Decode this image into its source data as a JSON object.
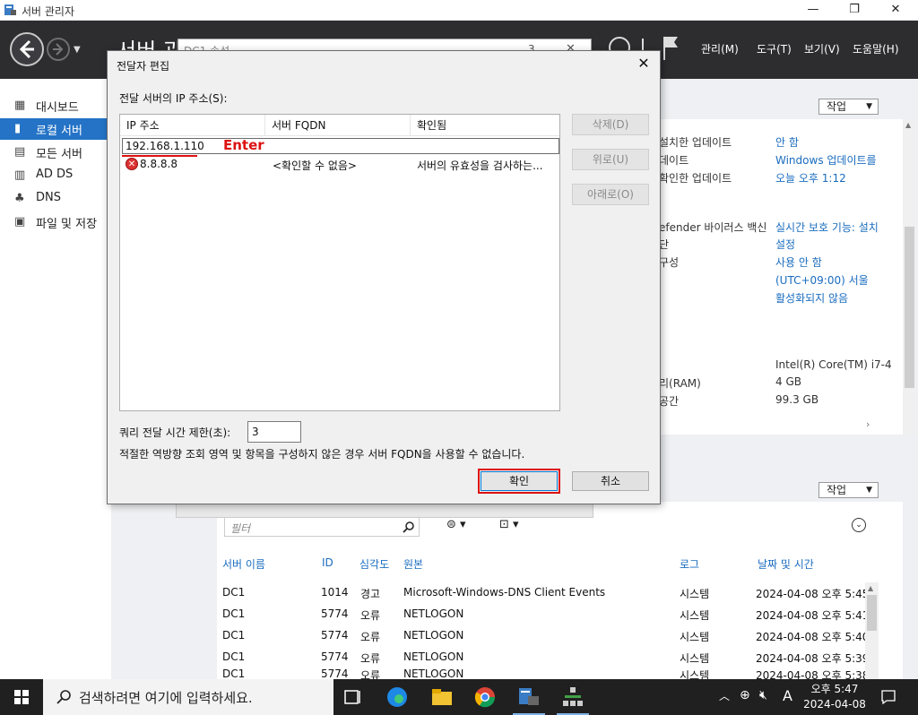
{
  "window": {
    "title": "서버 관리자",
    "minimize": "—",
    "maximize": "❐",
    "close": "✕"
  },
  "header": {
    "breadcrumb_title": "서버 관",
    "search_placeholder": "DC1 속성",
    "search_count": "3",
    "menus": [
      "관리(M)",
      "도구(T)",
      "보기(V)",
      "도움말(H)"
    ]
  },
  "sidebar": {
    "items": [
      {
        "label": "대시보드",
        "icon": "dashboard-icon"
      },
      {
        "label": "로컬 서버",
        "icon": "local-server-icon",
        "active": true
      },
      {
        "label": "모든 서버",
        "icon": "all-servers-icon"
      },
      {
        "label": "AD DS",
        "icon": "ad-ds-icon"
      },
      {
        "label": "DNS",
        "icon": "dns-icon"
      },
      {
        "label": "파일 및 저장",
        "icon": "file-storage-icon"
      }
    ]
  },
  "properties": {
    "task_label": "작업",
    "left": [
      "설치한 업데이트",
      "데이트",
      "확인한 업데이트",
      "efender 바이러스 백신",
      "단",
      "구성",
      "리(RAM)",
      "공간"
    ],
    "right": [
      "안 함",
      "Windows 업데이트를",
      "오늘 오후 1:12",
      "실시간 보호 기능: 설치",
      "설정",
      "사용 안 함",
      "(UTC+09:00) 서울",
      "활성화되지 않음",
      "Intel(R) Core(TM) i7-4",
      "4 GB",
      "99.3 GB"
    ]
  },
  "events": {
    "task_label": "작업",
    "filter_placeholder": "필터",
    "columns": [
      "서버 이름",
      "ID",
      "심각도",
      "원본",
      "로그",
      "날짜 및 시간"
    ],
    "rows": [
      [
        "DC1",
        "1014",
        "경고",
        "Microsoft-Windows-DNS Client Events",
        "시스템",
        "2024-04-08 오후 5:45"
      ],
      [
        "DC1",
        "5774",
        "오류",
        "NETLOGON",
        "시스템",
        "2024-04-08 오후 5:41"
      ],
      [
        "DC1",
        "5774",
        "오류",
        "NETLOGON",
        "시스템",
        "2024-04-08 오후 5:40"
      ],
      [
        "DC1",
        "5774",
        "오류",
        "NETLOGON",
        "시스템",
        "2024-04-08 오후 5:39"
      ],
      [
        "DC1",
        "5774",
        "오류",
        "NETLOGON",
        "시스템",
        "2024-04-08 오후 5:38"
      ]
    ]
  },
  "dialog": {
    "title": "전달자 편집",
    "close": "✕",
    "ip_label": "전달 서버의 IP 주소(S):",
    "columns": [
      "IP 주소",
      "서버 FQDN",
      "확인됨"
    ],
    "edit_value": "192.168.1.110",
    "annotation": "Enter",
    "rows": [
      {
        "ip": "8.8.8.8",
        "fqdn": "<확인할 수 없음>",
        "status": "서버의 유효성을 검사하는..."
      }
    ],
    "buttons": {
      "delete": "삭제(D)",
      "up": "위로(U)",
      "down": "아래로(O)",
      "ok": "확인",
      "cancel": "취소"
    },
    "timeout_label": "쿼리 전달 시간 제한(초):",
    "timeout_value": "3",
    "note": "적절한 역방향 조회 영역 및 항목을 구성하지 않은 경우 서버 FQDN을 사용할 수 없습니다."
  },
  "taskbar": {
    "search_placeholder": "검색하려면 여기에 입력하세요.",
    "ime": "A",
    "time": "오후 5:47",
    "date": "2024-04-08"
  },
  "colors": {
    "accent": "#2473c6",
    "header_bg": "#2d2d30",
    "annotation_red": "#dd1111",
    "link_blue": "#1a6cbf"
  }
}
